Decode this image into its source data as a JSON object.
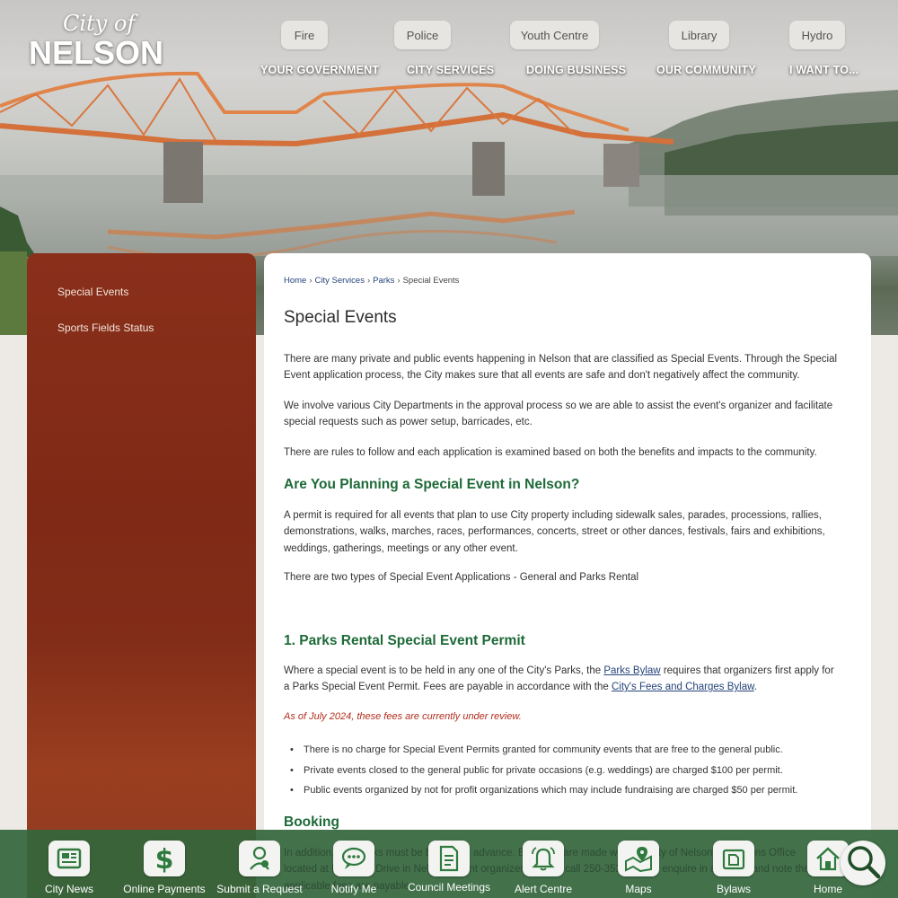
{
  "logo": {
    "line1": "City of",
    "line2": "NELSON"
  },
  "quick_buttons": [
    {
      "label": "Fire"
    },
    {
      "label": "Police"
    },
    {
      "label": "Youth Centre"
    },
    {
      "label": "Library"
    },
    {
      "label": "Hydro"
    }
  ],
  "main_nav": [
    {
      "label": "YOUR GOVERNMENT"
    },
    {
      "label": "CITY SERVICES"
    },
    {
      "label": "DOING BUSINESS"
    },
    {
      "label": "OUR COMMUNITY"
    },
    {
      "label": "I WANT TO..."
    }
  ],
  "sidebar": {
    "items": [
      {
        "label": "Special Events"
      },
      {
        "label": "Sports Fields Status"
      }
    ]
  },
  "breadcrumb": {
    "items": [
      {
        "label": "Home"
      },
      {
        "label": "City Services"
      },
      {
        "label": "Parks"
      },
      {
        "label": "Special Events"
      }
    ],
    "separator": "›"
  },
  "content": {
    "title": "Special Events",
    "p1": "There are many private and public events happening in Nelson that are classified as Special Events. Through the Special Event application process,  the City makes sure that all events are safe and don't negatively affect the community.",
    "p2": "We involve various City Departments in the approval process so we are able to assist the event's organizer and facilitate special requests such as power setup, barricades, etc.",
    "p3": "There are rules to follow and each application is examined based on both the benefits and impacts to the community.",
    "h2_planning": "Are You Planning a Special Event in Nelson?",
    "p4": "A permit is required for all events that plan to use City property including sidewalk sales, parades, processions, rallies, demonstrations, walks, marches, races, performances, concerts, street or other dances, festivals, fairs and exhibitions, weddings, gatherings, meetings or any other event.",
    "p5": "There are two types of Special Event Applications -  General and Parks Rental",
    "h2_parks": "1. Parks Rental Special Event Permit",
    "p6_a": "Where a special event is to be held in any one of the City's Parks, the ",
    "p6_link1": "Parks Bylaw",
    "p6_b": " requires that organizers first apply for a Parks Special Event Permit. Fees are payable in accordance with the ",
    "p6_link2": "City's Fees and Charges Bylaw",
    "p6_c": ".",
    "note": "As of July 2024, these fees are currently under review.",
    "bullets": [
      "There is no charge for Special Event Permits granted for community events that are free to the general public.",
      "Private events closed to the general public for private occasions (e.g. weddings) are charged $100 per permit.",
      "Public events organized by not for profit organizations which may include fundraising are charged $50 per permit."
    ],
    "h3_booking": "Booking",
    "booking_partial": "In addition, City parks must be booked in advance. Bookings are made with the City of Nelson Operations Office located at Lakeside Drive in Nelson. Event organizers should call 250-352-8238 to enquire in advance and note that applicable fees are payable."
  },
  "quick_links": [
    {
      "label": "City News",
      "icon": "news-icon"
    },
    {
      "label": "Online Payments",
      "icon": "dollar-icon"
    },
    {
      "label": "Submit a Request",
      "icon": "request-icon"
    },
    {
      "label": "Notify Me",
      "icon": "chat-icon"
    },
    {
      "label": "Council Meetings",
      "icon": "document-icon"
    },
    {
      "label": "Alert Centre",
      "icon": "bell-icon"
    },
    {
      "label": "Maps",
      "icon": "map-icon"
    },
    {
      "label": "Bylaws",
      "icon": "folder-icon"
    },
    {
      "label": "Home",
      "icon": "home-icon"
    }
  ],
  "search_icon": "search-icon",
  "colors": {
    "sidebar": "#8a2f1a",
    "heading_green": "#1e6a38",
    "link_blue": "#24437a",
    "note_red": "#b12d1c",
    "bottom_bar": "#34663c"
  }
}
